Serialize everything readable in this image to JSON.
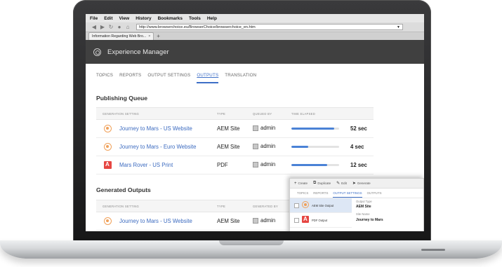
{
  "browser": {
    "menu": [
      "File",
      "Edit",
      "View",
      "History",
      "Bookmarks",
      "Tools",
      "Help"
    ],
    "url": "http://www.browserchoice.eu/BrowserChoice/browserchoice_en.htm",
    "tab_title": "Information Regarding Web Bro...",
    "icons": [
      "back-icon",
      "forward-icon",
      "reload-icon",
      "stop-icon",
      "home-icon"
    ]
  },
  "app": {
    "title": "Experience Manager"
  },
  "nav_tabs": [
    {
      "label": "TOPICS"
    },
    {
      "label": "REPORTS"
    },
    {
      "label": "OUTPUT SETTINGS"
    },
    {
      "label": "OUTPUTS",
      "active": true
    },
    {
      "label": "TRANSLATION"
    }
  ],
  "publishing_queue": {
    "title": "Publishing Queue",
    "headers": [
      "GENERATION SETTING",
      "TYPE",
      "QUEUED BY",
      "TIME ELAPSED"
    ],
    "rows": [
      {
        "name": "Journey to Mars - US Website",
        "type": "AEM Site",
        "user": "admin",
        "progress": 0.9,
        "elapsed": "52 sec",
        "icon": "aem-icon"
      },
      {
        "name": "Journey to Mars - Euro Website",
        "type": "AEM Site",
        "user": "admin",
        "progress": 0.35,
        "elapsed": "4 sec",
        "icon": "aem-icon"
      },
      {
        "name": "Mars Rover - US Print",
        "type": "PDF",
        "user": "admin",
        "progress": 0.75,
        "elapsed": "12 sec",
        "icon": "pdf-icon"
      }
    ]
  },
  "generated_outputs": {
    "title": "Generated Outputs",
    "headers": [
      "GENERATION SETTING",
      "TYPE",
      "GENERATED BY"
    ],
    "rows": [
      {
        "name": "Journey to Mars - US Website",
        "type": "AEM Site",
        "user": "admin",
        "icon": "aem-icon"
      }
    ]
  },
  "panel": {
    "toolbar": [
      "Create",
      "Duplicate",
      "Edit",
      "Generate"
    ],
    "tabs": [
      {
        "label": "TOPICS"
      },
      {
        "label": "REPORTS"
      },
      {
        "label": "OUTPUT SETTINGS",
        "active": true
      },
      {
        "label": "OUTPUTS"
      }
    ],
    "rows": [
      {
        "name": "AEM Site Output",
        "icon": "aem-icon",
        "selected": true
      },
      {
        "name": "PDF Output",
        "icon": "pdf-icon",
        "selected": false
      }
    ],
    "detail": {
      "output_type_label": "Output Type",
      "output_type_value": "AEM Site",
      "site_name_label": "Site Name",
      "site_name_value": "Journey to Mars"
    }
  }
}
